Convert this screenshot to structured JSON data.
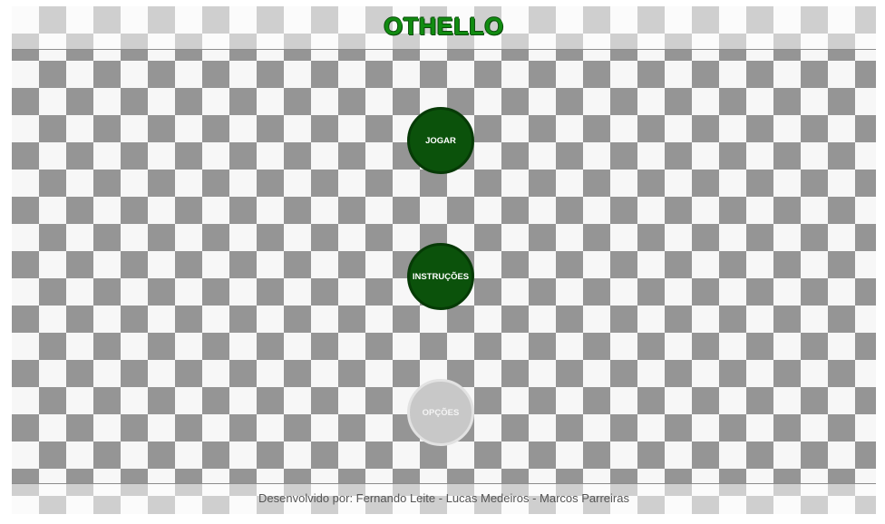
{
  "header": {
    "title": "OTHELLO"
  },
  "menu": {
    "play_label": "JOGAR",
    "instructions_label": "INSTRUÇÕES",
    "options_label": "OPÇÕES"
  },
  "footer": {
    "credits": "Desenvolvido por: Fernando Leite - Lucas Medeiros - Marcos Parreiras"
  },
  "colors": {
    "title_green": "#118c11",
    "button_green": "#0b520b",
    "button_disabled": "#c8c8c8",
    "checker_dark": "#959595",
    "checker_light": "#f7f7f7"
  }
}
